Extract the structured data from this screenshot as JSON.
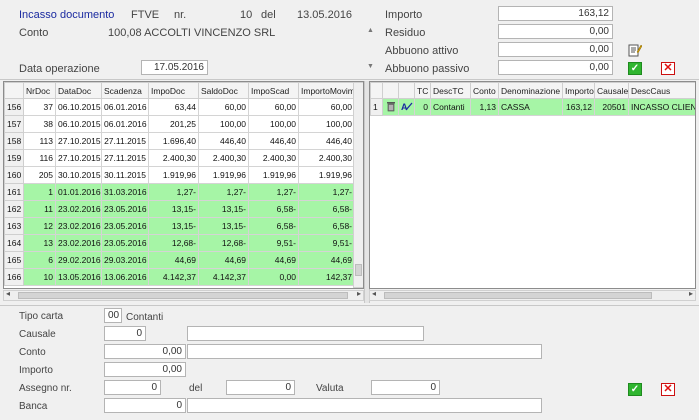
{
  "header": {
    "title": "Incasso documento",
    "doc_type": "FTVE",
    "nr_label": "nr.",
    "nr_value": "10",
    "del_label": "del",
    "date_value": "13.05.2016",
    "conto_label": "Conto",
    "conto_value": "100,08  ACCOLTI VINCENZO SRL",
    "data_operazione_label": "Data operazione",
    "data_operazione_value": "17.05.2016"
  },
  "totals": {
    "importo_label": "Importo",
    "importo_value": "163,12",
    "residuo_label": "Residuo",
    "residuo_value": "0,00",
    "abbuono_attivo_label": "Abbuono attivo",
    "abbuono_attivo_value": "0,00",
    "abbuono_passivo_label": "Abbuono passivo",
    "abbuono_passivo_value": "0,00"
  },
  "left_grid": {
    "columns": [
      "",
      "NrDoc",
      "DataDoc",
      "Scadenza",
      "ImpoDoc",
      "SaldoDoc",
      "ImpoScad",
      "ImportoMovim"
    ],
    "rows": [
      {
        "rn": "156",
        "nr": "37",
        "data": "06.10.2015",
        "scad": "06.01.2016",
        "impo": "63,44",
        "saldo": "60,00",
        "imposcad": "60,00",
        "movim": "60,00",
        "green": false
      },
      {
        "rn": "157",
        "nr": "38",
        "data": "06.10.2015",
        "scad": "06.01.2016",
        "impo": "201,25",
        "saldo": "100,00",
        "imposcad": "100,00",
        "movim": "100,00",
        "green": false
      },
      {
        "rn": "158",
        "nr": "113",
        "data": "27.10.2015",
        "scad": "27.11.2015",
        "impo": "1.696,40",
        "saldo": "446,40",
        "imposcad": "446,40",
        "movim": "446,40",
        "green": false
      },
      {
        "rn": "159",
        "nr": "116",
        "data": "27.10.2015",
        "scad": "27.11.2015",
        "impo": "2.400,30",
        "saldo": "2.400,30",
        "imposcad": "2.400,30",
        "movim": "2.400,30",
        "green": false
      },
      {
        "rn": "160",
        "nr": "205",
        "data": "30.10.2015",
        "scad": "30.11.2015",
        "impo": "1.919,96",
        "saldo": "1.919,96",
        "imposcad": "1.919,96",
        "movim": "1.919,96",
        "green": false
      },
      {
        "rn": "161",
        "nr": "1",
        "data": "01.01.2016",
        "scad": "31.03.2016",
        "impo": "1,27-",
        "saldo": "1,27-",
        "imposcad": "1,27-",
        "movim": "1,27-",
        "green": true
      },
      {
        "rn": "162",
        "nr": "11",
        "data": "23.02.2016",
        "scad": "23.05.2016",
        "impo": "13,15-",
        "saldo": "13,15-",
        "imposcad": "6,58-",
        "movim": "6,58-",
        "green": true
      },
      {
        "rn": "163",
        "nr": "12",
        "data": "23.02.2016",
        "scad": "23.05.2016",
        "impo": "13,15-",
        "saldo": "13,15-",
        "imposcad": "6,58-",
        "movim": "6,58-",
        "green": true
      },
      {
        "rn": "164",
        "nr": "13",
        "data": "23.02.2016",
        "scad": "23.05.2016",
        "impo": "12,68-",
        "saldo": "12,68-",
        "imposcad": "9,51-",
        "movim": "9,51-",
        "green": true
      },
      {
        "rn": "165",
        "nr": "6",
        "data": "29.02.2016",
        "scad": "29.03.2016",
        "impo": "44,69",
        "saldo": "44,69",
        "imposcad": "44,69",
        "movim": "44,69",
        "green": true
      },
      {
        "rn": "166",
        "nr": "10",
        "data": "13.05.2016",
        "scad": "13.06.2016",
        "impo": "4.142,37",
        "saldo": "4.142,37",
        "imposcad": "0,00",
        "movim": "142,37",
        "green": true
      }
    ]
  },
  "right_grid": {
    "columns": [
      "",
      "",
      "",
      "TC",
      "DescTC",
      "Conto",
      "Denominazione",
      "Importo",
      "Causale",
      "DescCaus"
    ],
    "rows": [
      {
        "rn": "1",
        "tc": "0",
        "desctc": "Contanti",
        "conto": "1,13",
        "denom": "CASSA",
        "importo": "163,12",
        "causale": "20501",
        "desccaus": "INCASSO CLIENTI"
      }
    ]
  },
  "form": {
    "tipo_carta_label": "Tipo carta",
    "tipo_carta_code": "00",
    "tipo_carta_desc": "Contanti",
    "causale_label": "Causale",
    "causale_value": "0",
    "conto_label": "Conto",
    "conto_value": "0,00",
    "importo_label": "Importo",
    "importo_value": "0,00",
    "assegno_label": "Assegno nr.",
    "assegno_value": "0",
    "del_label": "del",
    "del_value": "0",
    "valuta_label": "Valuta",
    "valuta_value": "0",
    "banca_label": "Banca",
    "banca_value": "0"
  },
  "colors": {
    "selected_row": "#a6f5a6",
    "title": "#1a2aa0",
    "confirm": "#2fb52f",
    "cancel": "#e01010"
  }
}
